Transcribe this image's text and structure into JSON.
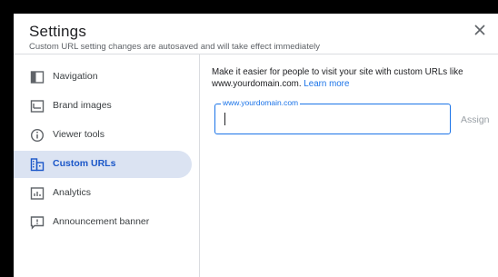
{
  "header": {
    "title": "Settings",
    "subtitle": "Custom URL setting changes are autosaved and will take effect immediately"
  },
  "sidebar": {
    "items": [
      {
        "label": "Navigation",
        "icon": "navigation-icon",
        "active": false
      },
      {
        "label": "Brand images",
        "icon": "image-icon",
        "active": false
      },
      {
        "label": "Viewer tools",
        "icon": "info-icon",
        "active": false
      },
      {
        "label": "Custom URLs",
        "icon": "building-icon",
        "active": true
      },
      {
        "label": "Analytics",
        "icon": "chart-icon",
        "active": false
      },
      {
        "label": "Announcement banner",
        "icon": "announcement-icon",
        "active": false
      }
    ]
  },
  "main": {
    "description": "Make it easier for people to visit your site with custom URLs like www.yourdomain.com.",
    "learn_more": "Learn more",
    "field_label": "www.yourdomain.com",
    "field_value": "",
    "assign_label": "Assign"
  },
  "colors": {
    "accent": "#1a73e8",
    "active_bg": "#dbe3f2",
    "active_text": "#1a56c8"
  }
}
